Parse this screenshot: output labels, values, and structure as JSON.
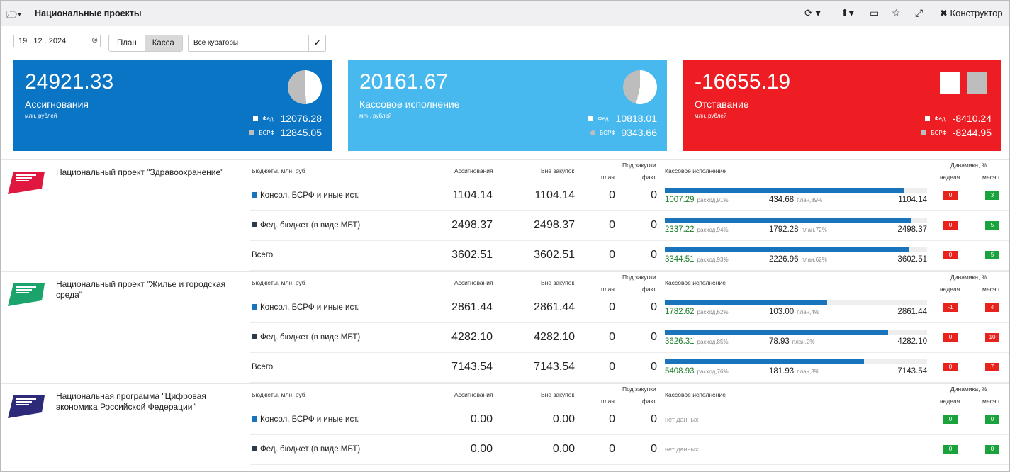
{
  "header": {
    "title": "Национальные проекты",
    "constructor_label": "Конструктор"
  },
  "filters": {
    "date": "19 . 12 . 2024",
    "seg_plan": "План",
    "seg_kassa": "Касса",
    "curator": "Все кураторы"
  },
  "cards": {
    "assign": {
      "value": "24921.33",
      "label": "Ассигнования",
      "unit": "млн. рублей",
      "fed_tag": "Фед.",
      "fed": "12076.28",
      "bsrf_tag": "БСРФ",
      "bsrf": "12845.05"
    },
    "exec": {
      "value": "20161.67",
      "label": "Кассовое исполнение",
      "unit": "млн. рублей",
      "fed_tag": "Фед.",
      "fed": "10818.01",
      "bsrf_tag": "БСРФ",
      "bsrf": "9343.66"
    },
    "lag": {
      "value": "-16655.19",
      "label": "Отставание",
      "unit": "млн. рублей",
      "fed_tag": "Фед.",
      "fed": "-8410.24",
      "bsrf_tag": "БСРФ",
      "bsrf": "-8244.95"
    }
  },
  "colors": {
    "blue": "#0a74c5",
    "lightblue": "#47b9ee",
    "red": "#ee1d23",
    "bar": "#1a74bb"
  },
  "table_headers": {
    "budgets": "Бюджеты, млн. руб",
    "assign": "Ассигнования",
    "outside": "Вне закупок",
    "under": "Под закупки",
    "plan": "план",
    "fact": "факт",
    "exec": "Кассовое исполнение",
    "dyn": "Динамика, %",
    "week": "неделя",
    "month": "месяц"
  },
  "projects": [
    {
      "title": "Национальный проект \"Здравоохранение\"",
      "rows": [
        {
          "name": "Консол. БСРФ и иные ист.",
          "assign": "1104.14",
          "outside": "1104.14",
          "plan": "0",
          "fact": "0",
          "exec": "1007.29",
          "exec_pct": "расход,91%",
          "plan_val": "434.68",
          "plan_pct": "план,39%",
          "total": "1104.14",
          "bar": 0.91,
          "week": "0",
          "month": "3"
        },
        {
          "name": "Фед. бюджет (в виде МБТ)",
          "assign": "2498.37",
          "outside": "2498.37",
          "plan": "0",
          "fact": "0",
          "exec": "2337.22",
          "exec_pct": "расход,94%",
          "plan_val": "1792.28",
          "plan_pct": "план,72%",
          "total": "2498.37",
          "bar": 0.94,
          "week": "0",
          "month": "5"
        },
        {
          "name": "Всего",
          "assign": "3602.51",
          "outside": "3602.51",
          "plan": "0",
          "fact": "0",
          "exec": "3344.51",
          "exec_pct": "расход,93%",
          "plan_val": "2226.96",
          "plan_pct": "план,62%",
          "total": "3602.51",
          "bar": 0.93,
          "week": "0",
          "month": "5"
        }
      ]
    },
    {
      "title": "Национальный проект \"Жилье и городская среда\"",
      "rows": [
        {
          "name": "Консол. БСРФ и иные ист.",
          "assign": "2861.44",
          "outside": "2861.44",
          "plan": "0",
          "fact": "0",
          "exec": "1782.62",
          "exec_pct": "расход,62%",
          "plan_val": "103.00",
          "plan_pct": "план,4%",
          "total": "2861.44",
          "bar": 0.62,
          "week": "-1",
          "month": "4"
        },
        {
          "name": "Фед. бюджет (в виде МБТ)",
          "assign": "4282.10",
          "outside": "4282.10",
          "plan": "0",
          "fact": "0",
          "exec": "3626.31",
          "exec_pct": "расход,85%",
          "plan_val": "78.93",
          "plan_pct": "план,2%",
          "total": "4282.10",
          "bar": 0.85,
          "week": "0",
          "month": "10"
        },
        {
          "name": "Всего",
          "assign": "7143.54",
          "outside": "7143.54",
          "plan": "0",
          "fact": "0",
          "exec": "5408.93",
          "exec_pct": "расход,76%",
          "plan_val": "181.93",
          "plan_pct": "план,3%",
          "total": "7143.54",
          "bar": 0.76,
          "week": "0",
          "month": "7"
        }
      ]
    },
    {
      "title": "Национальная программа \"Цифровая экономика Российской Федерации\"",
      "rows": [
        {
          "name": "Консол. БСРФ и иные ист.",
          "assign": "0.00",
          "outside": "0.00",
          "plan": "0",
          "fact": "0",
          "nodata": "нет данных",
          "week": "0",
          "month": "0"
        },
        {
          "name": "Фед. бюджет (в виде МБТ)",
          "assign": "0.00",
          "outside": "0.00",
          "plan": "0",
          "fact": "0",
          "nodata": "нет данных",
          "week": "0",
          "month": "0"
        }
      ]
    }
  ]
}
